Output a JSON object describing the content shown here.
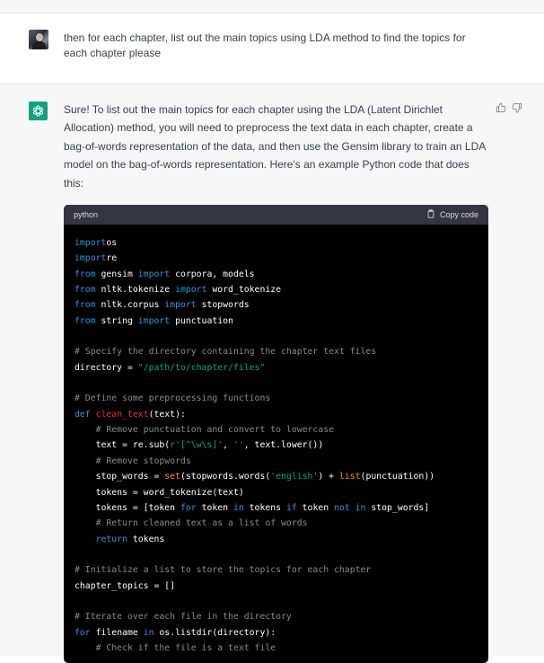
{
  "user_message": {
    "text": "then for each chapter, list out the main topics using LDA method to find the topics for each chapter please"
  },
  "assistant_message": {
    "text": "Sure! To list out the main topics for each chapter using the LDA (Latent Dirichlet Allocation) method, you will need to preprocess the text data in each chapter, create a bag-of-words representation of the data, and then use the Gensim library to train an LDA model on the bag-of-words representation. Here's an example Python code that does this:",
    "code_block": {
      "language": "python",
      "copy_label": "Copy code",
      "lines": [
        [
          [
            "kw",
            "import"
          ],
          [
            "",
            "os"
          ]
        ],
        [
          [
            "kw",
            "import"
          ],
          [
            "",
            "re"
          ]
        ],
        [
          [
            "kw",
            "from"
          ],
          [
            "",
            " gensim "
          ],
          [
            "kw",
            "import"
          ],
          [
            "",
            " corpora, models"
          ]
        ],
        [
          [
            "kw",
            "from"
          ],
          [
            "",
            " nltk.tokenize "
          ],
          [
            "kw",
            "import"
          ],
          [
            "",
            " word_tokenize"
          ]
        ],
        [
          [
            "kw",
            "from"
          ],
          [
            "",
            " nltk.corpus "
          ],
          [
            "kw",
            "import"
          ],
          [
            "",
            " stopwords"
          ]
        ],
        [
          [
            "kw",
            "from"
          ],
          [
            "",
            " string "
          ],
          [
            "kw",
            "import"
          ],
          [
            "",
            " punctuation"
          ]
        ],
        [],
        [
          [
            "cm",
            "# Specify the directory containing the chapter text files"
          ]
        ],
        [
          [
            "",
            "directory = "
          ],
          [
            "st",
            "\"/path/to/chapter/files\""
          ]
        ],
        [],
        [
          [
            "cm",
            "# Define some preprocessing functions"
          ]
        ],
        [
          [
            "kw",
            "def"
          ],
          [
            "",
            " "
          ],
          [
            "fn",
            "clean_text"
          ],
          [
            "",
            "(text):"
          ]
        ],
        [
          [
            "",
            "    "
          ],
          [
            "cm",
            "# Remove punctuation and convert to lowercase"
          ]
        ],
        [
          [
            "",
            "    text = re.sub("
          ],
          [
            "st",
            "r'[^\\w\\s]'"
          ],
          [
            "",
            ", "
          ],
          [
            "st",
            "''"
          ],
          [
            "",
            ", text.lower())"
          ]
        ],
        [
          [
            "",
            "    "
          ],
          [
            "cm",
            "# Remove stopwords"
          ]
        ],
        [
          [
            "",
            "    stop_words = "
          ],
          [
            "bi",
            "set"
          ],
          [
            "",
            "(stopwords.words("
          ],
          [
            "st",
            "'english'"
          ],
          [
            "",
            ") + "
          ],
          [
            "bi",
            "list"
          ],
          [
            "",
            "(punctuation))"
          ]
        ],
        [
          [
            "",
            "    tokens = word_tokenize(text)"
          ]
        ],
        [
          [
            "",
            "    tokens = [token "
          ],
          [
            "kw",
            "for"
          ],
          [
            "",
            " token "
          ],
          [
            "kw",
            "in"
          ],
          [
            "",
            " tokens "
          ],
          [
            "kw",
            "if"
          ],
          [
            "",
            " token "
          ],
          [
            "kw",
            "not in"
          ],
          [
            "",
            " stop_words]"
          ]
        ],
        [
          [
            "",
            "    "
          ],
          [
            "cm",
            "# Return cleaned text as a list of words"
          ]
        ],
        [
          [
            "",
            "    "
          ],
          [
            "kw",
            "return"
          ],
          [
            "",
            " tokens"
          ]
        ],
        [],
        [
          [
            "cm",
            "# Initialize a list to store the topics for each chapter"
          ]
        ],
        [
          [
            "",
            "chapter_topics = []"
          ]
        ],
        [],
        [
          [
            "cm",
            "# Iterate over each file in the directory"
          ]
        ],
        [
          [
            "kw",
            "for"
          ],
          [
            "",
            " filename "
          ],
          [
            "kw",
            "in"
          ],
          [
            "",
            " os.listdir(directory):"
          ]
        ],
        [
          [
            "",
            "    "
          ],
          [
            "cm",
            "# Check if the file is a text file"
          ]
        ]
      ]
    }
  },
  "icons": {
    "thumbs_up": "thumbs-up-icon",
    "thumbs_down": "thumbs-down-icon",
    "copy": "clipboard-icon",
    "assistant_avatar": "openai-logo-icon"
  },
  "colors": {
    "assistant_bg": "#f7f7f8",
    "avatar_green": "#10a37f",
    "code_bg": "#000000",
    "code_header": "#343541",
    "keyword": "#2e95d3",
    "function": "#f22c3d",
    "builtin": "#e9950c",
    "string": "#00a67d",
    "comment": "#8a8a8a"
  }
}
